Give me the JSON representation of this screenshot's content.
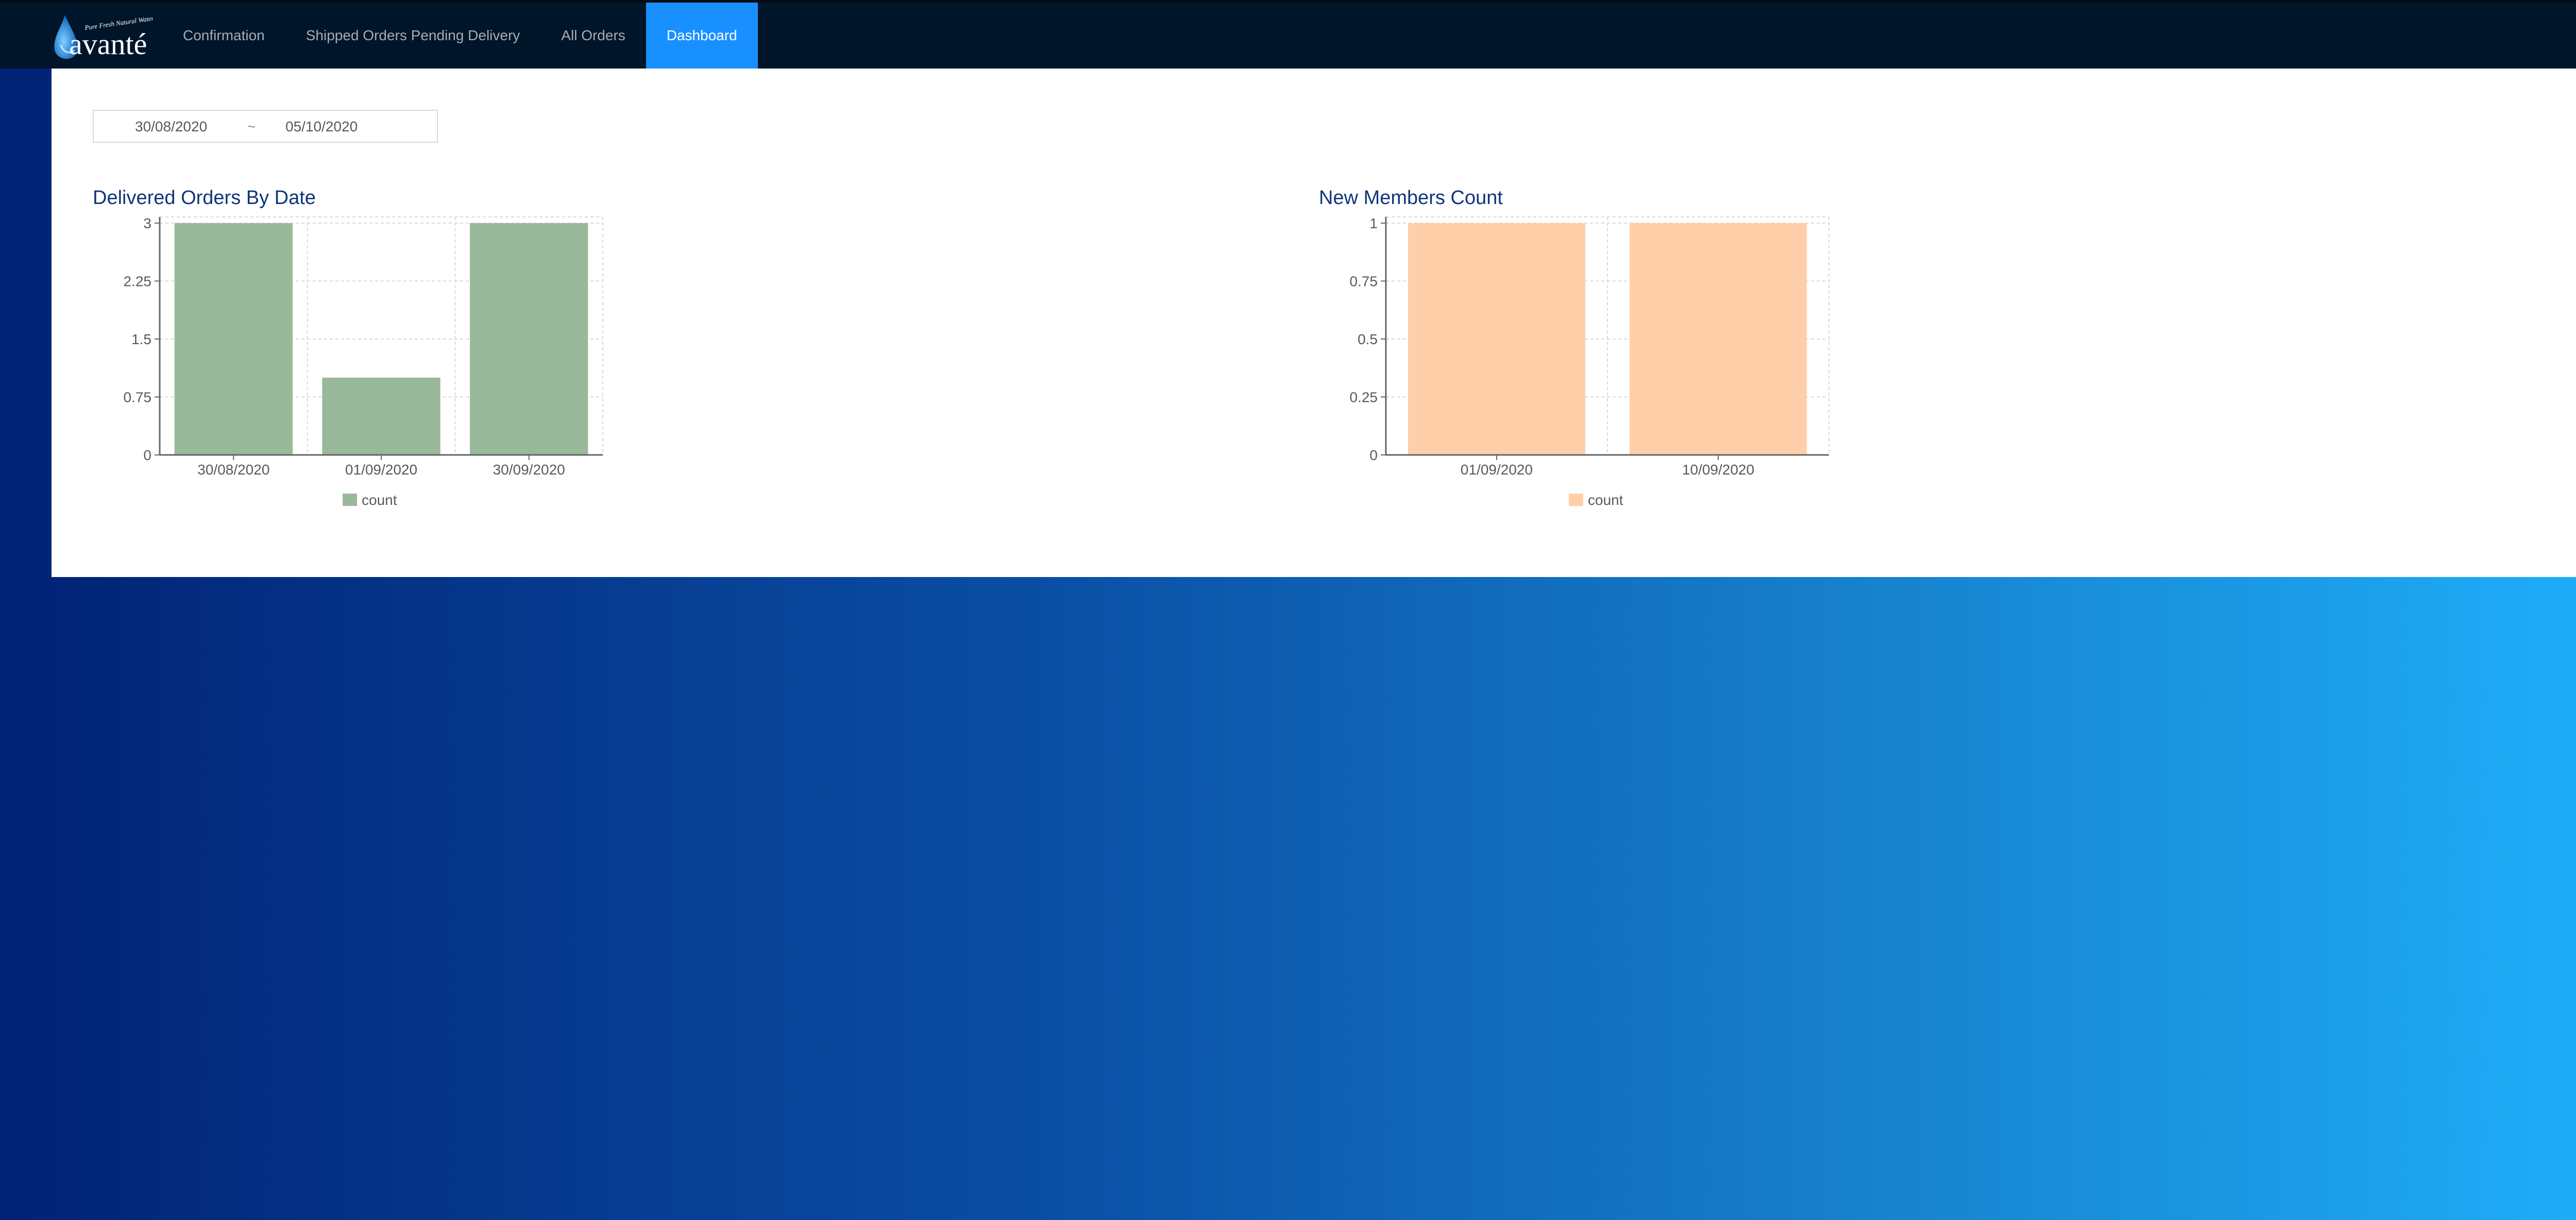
{
  "header": {
    "logo_icon": "avante-water-drop-logo",
    "logo_tagline": "Pure Fresh Natural Water",
    "logo_brand": "avanté",
    "nav_items": [
      {
        "label": "Confirmation",
        "active": false
      },
      {
        "label": "Shipped Orders Pending Delivery",
        "active": false
      },
      {
        "label": "All Orders",
        "active": false
      },
      {
        "label": "Dashboard",
        "active": true
      }
    ],
    "power_icon": "power-icon",
    "accent_color": "#1890ff",
    "power_color": "#e24a4a"
  },
  "filters": {
    "date_range": {
      "start": "30/08/2020",
      "separator": "~",
      "end": "05/10/2020"
    }
  },
  "chart_data": [
    {
      "type": "bar",
      "title": "Delivered Orders By Date",
      "categories": [
        "30/08/2020",
        "01/09/2020",
        "30/09/2020"
      ],
      "series": [
        {
          "name": "count",
          "values": [
            3,
            1,
            3
          ],
          "color": "#9ab99a"
        }
      ],
      "yticks": [
        "0",
        "0.75",
        "1.5",
        "2.25",
        "3"
      ],
      "ylim": [
        0,
        3
      ],
      "grid": true,
      "legend": "bottom"
    },
    {
      "type": "bar",
      "title": "New Members Count",
      "categories": [
        "01/09/2020",
        "10/09/2020"
      ],
      "series": [
        {
          "name": "count",
          "values": [
            1,
            1
          ],
          "color": "#ffcfaa"
        }
      ],
      "yticks": [
        "0",
        "0.25",
        "0.5",
        "0.75",
        "1"
      ],
      "ylim": [
        0,
        1
      ],
      "grid": true,
      "legend": "bottom"
    }
  ]
}
